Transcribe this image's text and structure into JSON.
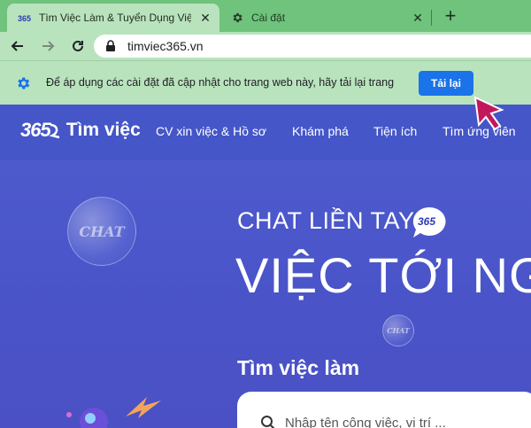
{
  "browser": {
    "tabs": [
      {
        "title": "Tìm Việc Làm & Tuyển Dụng Việc",
        "icon": "site-favicon",
        "active": true
      },
      {
        "title": "Cài đặt",
        "icon": "settings-gear-icon",
        "active": false
      }
    ],
    "new_tab_label": "+",
    "url": "timviec365.vn",
    "colors": {
      "frame": "#6fc37c",
      "toolbar": "#b9e3bd",
      "accent": "#1a73e8"
    }
  },
  "infobar": {
    "message": "Để áp dụng các cài đặt đã cập nhật cho trang web này, hãy tải lại trang",
    "button_label": "Tải lại"
  },
  "site": {
    "logo_number": "365",
    "logo_name": "Tìm việc",
    "nav": [
      "CV xin việc & Hồ sơ",
      "Khám phá",
      "Tiện ích",
      "Tìm ứng viên"
    ],
    "hero": {
      "line1": "CHAT LIỀN TAY",
      "badge_text": "365",
      "line2": "VIỆC TỚI NGAY",
      "bubble_text": "CHAT",
      "section_title": "Tìm việc làm",
      "search_placeholder": "Nhập tên công việc, vị trí ..."
    },
    "colors": {
      "header": "#4556c8",
      "hero": "#4b57cc"
    }
  }
}
